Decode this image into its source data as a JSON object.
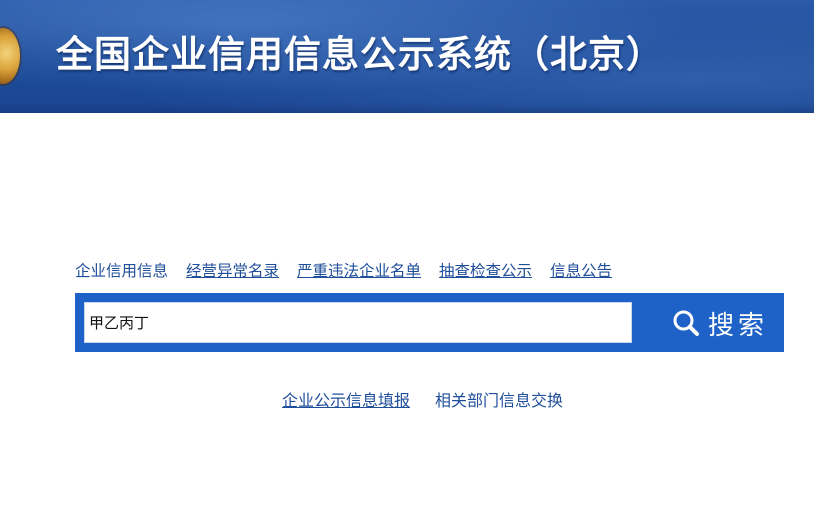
{
  "header": {
    "title": "全国企业信用信息公示系统（北京）"
  },
  "nav": {
    "items": [
      {
        "label": "企业信用信息",
        "underlined": false
      },
      {
        "label": "经营异常名录",
        "underlined": true
      },
      {
        "label": "严重违法企业名单",
        "underlined": true
      },
      {
        "label": "抽查检查公示",
        "underlined": true
      },
      {
        "label": "信息公告",
        "underlined": true
      }
    ]
  },
  "search": {
    "value": "甲乙丙丁",
    "button_label": "搜索"
  },
  "bottom_links": [
    {
      "label": "企业公示信息填报"
    },
    {
      "label": "相关部门信息交换"
    }
  ],
  "colors": {
    "header_blue": "#1f4e9a",
    "search_bar_blue": "#1e62c7",
    "link_blue": "#1f4e9a"
  },
  "icons": {
    "emblem": "national-emblem-icon",
    "search": "search-icon"
  }
}
